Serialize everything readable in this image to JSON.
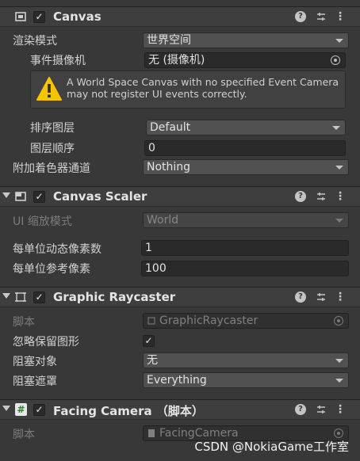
{
  "canvas": {
    "title": "Canvas",
    "enabled_check": "✓",
    "render_mode_label": "渲染模式",
    "render_mode_value": "世界空间",
    "event_camera_label": "事件摄像机",
    "event_camera_value": "无 (摄像机)",
    "warning_text": "A World Space Canvas with no specified Event Camera may not register UI events correctly.",
    "sorting_layer_label": "排序图层",
    "sorting_layer_value": "Default",
    "order_in_layer_label": "图层顺序",
    "order_in_layer_value": "0",
    "shader_channels_label": "附加着色器通道",
    "shader_channels_value": "Nothing"
  },
  "canvas_scaler": {
    "title": "Canvas Scaler",
    "enabled_check": "✓",
    "ui_scale_mode_label": "UI 缩放模式",
    "ui_scale_mode_value": "World",
    "dynamic_ppu_label": "每单位动态像素数",
    "dynamic_ppu_value": "1",
    "reference_ppu_label": "每单位参考像素",
    "reference_ppu_value": "100"
  },
  "graphic_raycaster": {
    "title": "Graphic Raycaster",
    "enabled_check": "✓",
    "script_label": "脚本",
    "script_value": "GraphicRaycaster",
    "ignore_reversed_label": "忽略保留图形",
    "ignore_reversed_check": "✓",
    "blocking_objects_label": "阻塞对象",
    "blocking_objects_value": "无",
    "blocking_mask_label": "阻塞遮罩",
    "blocking_mask_value": "Everything"
  },
  "facing_camera": {
    "title": "Facing Camera （脚本）",
    "enabled_check": "✓",
    "script_label": "脚本",
    "script_value": "FacingCamera"
  },
  "header_buttons": {
    "help": "?",
    "menu": "⋮"
  },
  "watermark": "CSDN @NokiaGame工作室",
  "colors": {
    "background": "#383838",
    "header": "#3e3e3e",
    "field": "#2a2a2a",
    "dropdown": "#515151",
    "warning": "#f5c400"
  }
}
